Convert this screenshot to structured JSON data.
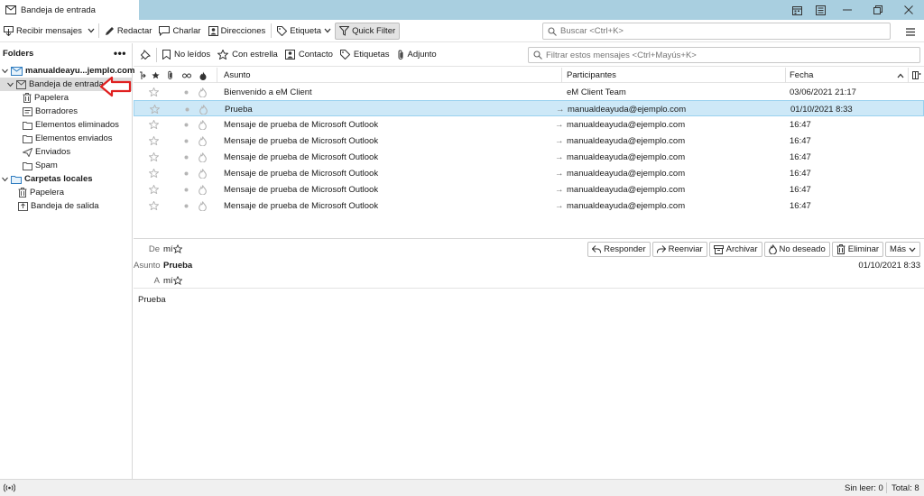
{
  "window": {
    "tab_title": "Bandeja de entrada"
  },
  "toolbar": {
    "receive": "Recibir mensajes",
    "compose": "Redactar",
    "chat": "Charlar",
    "contacts": "Direcciones",
    "tag": "Etiqueta",
    "quick_filter": "Quick Filter",
    "search_placeholder": "Buscar <Ctrl+K>"
  },
  "sidebar": {
    "header": "Folders",
    "account": "manualdeayu...jemplo.com",
    "inbox": "Bandeja de entrada",
    "folders": [
      "Papelera",
      "Borradores",
      "Elementos eliminados",
      "Elementos enviados",
      "Enviados",
      "Spam"
    ],
    "local_title": "Carpetas locales",
    "local_folders": [
      "Papelera",
      "Bandeja de salida"
    ]
  },
  "filterbar": {
    "unread": "No leídos",
    "starred": "Con estrella",
    "contact": "Contacto",
    "tags": "Etiquetas",
    "attachment": "Adjunto",
    "placeholder": "Filtrar estos mensajes <Ctrl+Mayús+K>"
  },
  "columns": {
    "subject": "Asunto",
    "participants": "Participantes",
    "date": "Fecha"
  },
  "messages": [
    {
      "subject": "Bienvenido a eM Client",
      "participant": "eM Client Team",
      "date": "03/06/2021 21:17",
      "arrow": ""
    },
    {
      "subject": "Prueba",
      "participant": "manualdeayuda@ejemplo.com",
      "date": "01/10/2021 8:33",
      "arrow": "→"
    },
    {
      "subject": "Mensaje de prueba de Microsoft Outlook",
      "participant": "manualdeayuda@ejemplo.com",
      "date": "16:47",
      "arrow": "→"
    },
    {
      "subject": "Mensaje de prueba de Microsoft Outlook",
      "participant": "manualdeayuda@ejemplo.com",
      "date": "16:47",
      "arrow": "→"
    },
    {
      "subject": "Mensaje de prueba de Microsoft Outlook",
      "participant": "manualdeayuda@ejemplo.com",
      "date": "16:47",
      "arrow": "→"
    },
    {
      "subject": "Mensaje de prueba de Microsoft Outlook",
      "participant": "manualdeayuda@ejemplo.com",
      "date": "16:47",
      "arrow": "→"
    },
    {
      "subject": "Mensaje de prueba de Microsoft Outlook",
      "participant": "manualdeayuda@ejemplo.com",
      "date": "16:47",
      "arrow": "→"
    },
    {
      "subject": "Mensaje de prueba de Microsoft Outlook",
      "participant": "manualdeayuda@ejemplo.com",
      "date": "16:47",
      "arrow": "→"
    }
  ],
  "preview": {
    "from_label": "De",
    "from": "mí",
    "subject_label": "Asunto",
    "subject": "Prueba",
    "to_label": "A",
    "to": "mí",
    "date": "01/10/2021 8:33",
    "body": "Prueba",
    "actions": {
      "reply": "Responder",
      "forward": "Reenviar",
      "archive": "Archivar",
      "junk": "No deseado",
      "delete": "Eliminar",
      "more": "Más"
    }
  },
  "status": {
    "unread": "Sin leer: 0",
    "total": "Total: 8"
  },
  "colors": {
    "titlebar": "#a9cfe0",
    "selected_row": "#cde8f7",
    "annotation_arrow": "#e02020"
  }
}
